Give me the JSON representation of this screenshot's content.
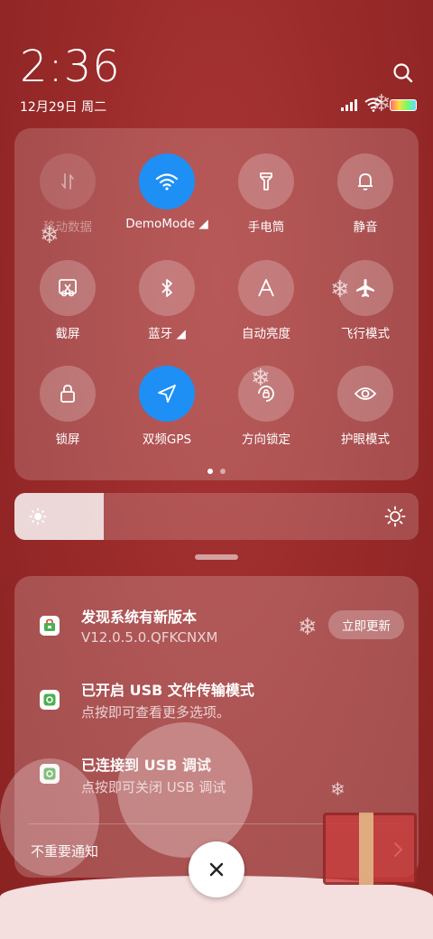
{
  "status": {
    "time": "2:36",
    "date": "12月29日 周二"
  },
  "quick_settings": {
    "tiles": [
      {
        "label": "移动数据",
        "icon": "mobile-data-icon",
        "state": "disabled"
      },
      {
        "label": "DemoMode ◢",
        "icon": "wifi-icon",
        "state": "on"
      },
      {
        "label": "手电筒",
        "icon": "flashlight-icon",
        "state": "off"
      },
      {
        "label": "静音",
        "icon": "bell-icon",
        "state": "off"
      },
      {
        "label": "截屏",
        "icon": "screenshot-icon",
        "state": "off"
      },
      {
        "label": "蓝牙 ◢",
        "icon": "bluetooth-icon",
        "state": "off"
      },
      {
        "label": "自动亮度",
        "icon": "auto-brightness-icon",
        "state": "off"
      },
      {
        "label": "飞行模式",
        "icon": "airplane-icon",
        "state": "off"
      },
      {
        "label": "锁屏",
        "icon": "lock-icon",
        "state": "off"
      },
      {
        "label": "双频GPS",
        "icon": "gps-icon",
        "state": "on"
      },
      {
        "label": "方向锁定",
        "icon": "rotation-lock-icon",
        "state": "off"
      },
      {
        "label": "护眼模式",
        "icon": "eye-icon",
        "state": "off"
      }
    ],
    "pages": 2,
    "current_page": 1
  },
  "brightness": {
    "level": 0.22
  },
  "notifications": [
    {
      "title": "发现系统有新版本",
      "subtitle": "V12.0.5.0.QFKCNXM",
      "action": "立即更新"
    },
    {
      "title": "已开启 USB 文件传输模式",
      "subtitle": "点按即可查看更多选项。"
    },
    {
      "title": "已连接到 USB 调试",
      "subtitle": "点按即可关闭 USB 调试"
    }
  ],
  "unimportant_label": "不重要通知",
  "colors": {
    "background": "#9d2b2b",
    "accent": "#1e8ff5"
  }
}
